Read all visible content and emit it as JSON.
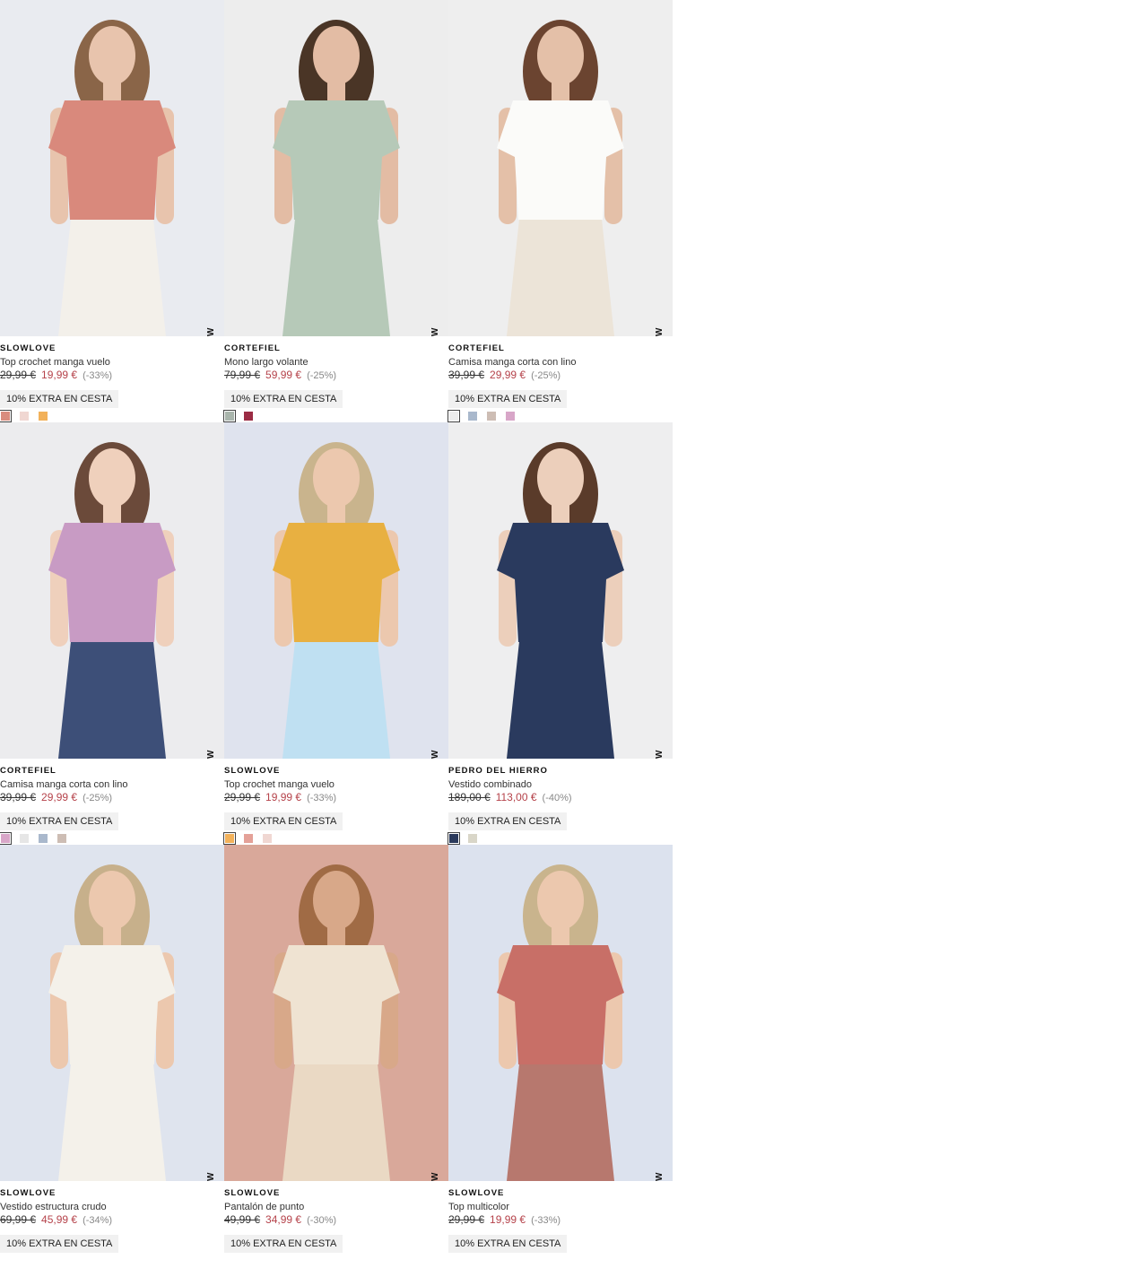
{
  "products": [
    {
      "brand": "SLOWLOVE",
      "name": "Top crochet manga vuelo",
      "old_price": "29,99 €",
      "price": "19,99 €",
      "discount": "(-33%)",
      "promo": "10% EXTRA EN CESTA",
      "badge": "NEW",
      "swatches": [
        "#d98c7e",
        "#f0d7d2",
        "#f2b15a"
      ]
    },
    {
      "brand": "CORTEFIEL",
      "name": "Mono largo volante",
      "old_price": "79,99 €",
      "price": "59,99 €",
      "discount": "(-25%)",
      "promo": "10% EXTRA EN CESTA",
      "badge": "NEW",
      "swatches": [
        "#a9b5ac",
        "#9b2c44"
      ]
    },
    {
      "brand": "CORTEFIEL",
      "name": "Camisa manga corta con lino",
      "old_price": "39,99 €",
      "price": "29,99 €",
      "discount": "(-25%)",
      "promo": "10% EXTRA EN CESTA",
      "badge": "NEW",
      "swatches": [
        "#ececec",
        "#a9b8cc",
        "#cdbdb4",
        "#d8a6c8"
      ]
    },
    {
      "brand": "CORTEFIEL",
      "name": "Camisa manga corta con lino",
      "old_price": "39,99 €",
      "price": "29,99 €",
      "discount": "(-25%)",
      "promo": "10% EXTRA EN CESTA",
      "badge": "NEW",
      "swatches": [
        "#d8a6c8",
        "#e6e6e6",
        "#a9b8cc",
        "#cdbdb4"
      ]
    },
    {
      "brand": "SLOWLOVE",
      "name": "Top crochet manga vuelo",
      "old_price": "29,99 €",
      "price": "19,99 €",
      "discount": "(-33%)",
      "promo": "10% EXTRA EN CESTA",
      "badge": "NEW",
      "swatches": [
        "#f2b15a",
        "#e4a198",
        "#f0d7d2"
      ]
    },
    {
      "brand": "PEDRO DEL HIERRO",
      "name": "Vestido combinado",
      "old_price": "189,00 €",
      "price": "113,00 €",
      "discount": "(-40%)",
      "promo": "10% EXTRA EN CESTA",
      "badge": "NEW",
      "swatches": [
        "#2b3a5c",
        "#d9d6c8"
      ]
    },
    {
      "brand": "SLOWLOVE",
      "name": "Vestido estructura crudo",
      "old_price": "69,99 €",
      "price": "45,99 €",
      "discount": "(-34%)",
      "promo": "10% EXTRA EN CESTA",
      "badge": "NEW",
      "swatches": []
    },
    {
      "brand": "SLOWLOVE",
      "name": "Pantalón de punto",
      "old_price": "49,99 €",
      "price": "34,99 €",
      "discount": "(-30%)",
      "promo": "10% EXTRA EN CESTA",
      "badge": "NEW",
      "swatches": []
    },
    {
      "brand": "SLOWLOVE",
      "name": "Top multicolor",
      "old_price": "29,99 €",
      "price": "19,99 €",
      "discount": "(-33%)",
      "promo": "10% EXTRA EN CESTA",
      "badge": "NEW",
      "swatches": []
    }
  ],
  "photo_colors": [
    {
      "bg": "#e9ebf0",
      "garment": "#d9897c",
      "skin": "#e8c4ad",
      "hair": "#8a6548",
      "bottom": "#f3f0ea"
    },
    {
      "bg": "#ededed",
      "garment": "#b6c9b8",
      "skin": "#e3bca4",
      "hair": "#4a3526",
      "bottom": "#b6c9b8"
    },
    {
      "bg": "#eeeeee",
      "garment": "#fbfbf9",
      "skin": "#e4c0a8",
      "hair": "#6b4430",
      "bottom": "#ece4d8"
    },
    {
      "bg": "#ececee",
      "garment": "#c89bc4",
      "skin": "#efd0bc",
      "hair": "#6b4a3a",
      "bottom": "#3d4f78"
    },
    {
      "bg": "#dfe3ee",
      "garment": "#e8b041",
      "skin": "#ecc8ae",
      "hair": "#c9b48d",
      "bottom": "#bfe0f2"
    },
    {
      "bg": "#eeeeef",
      "garment": "#2a3a5e",
      "skin": "#eccfbb",
      "hair": "#5a3b2a",
      "bottom": "#2a3a5e"
    },
    {
      "bg": "#dfe4ee",
      "garment": "#f4f1ea",
      "skin": "#ecc8ae",
      "hair": "#c7b08b",
      "bottom": "#f4f1ea"
    },
    {
      "bg": "#d9a89a",
      "garment": "#efe3d2",
      "skin": "#d8a889",
      "hair": "#a06b45",
      "bottom": "#ead9c4"
    },
    {
      "bg": "#dce2ee",
      "garment": "#c86f67",
      "skin": "#ecc8ae",
      "hair": "#c9b48d",
      "bottom": "#b7786e"
    }
  ]
}
